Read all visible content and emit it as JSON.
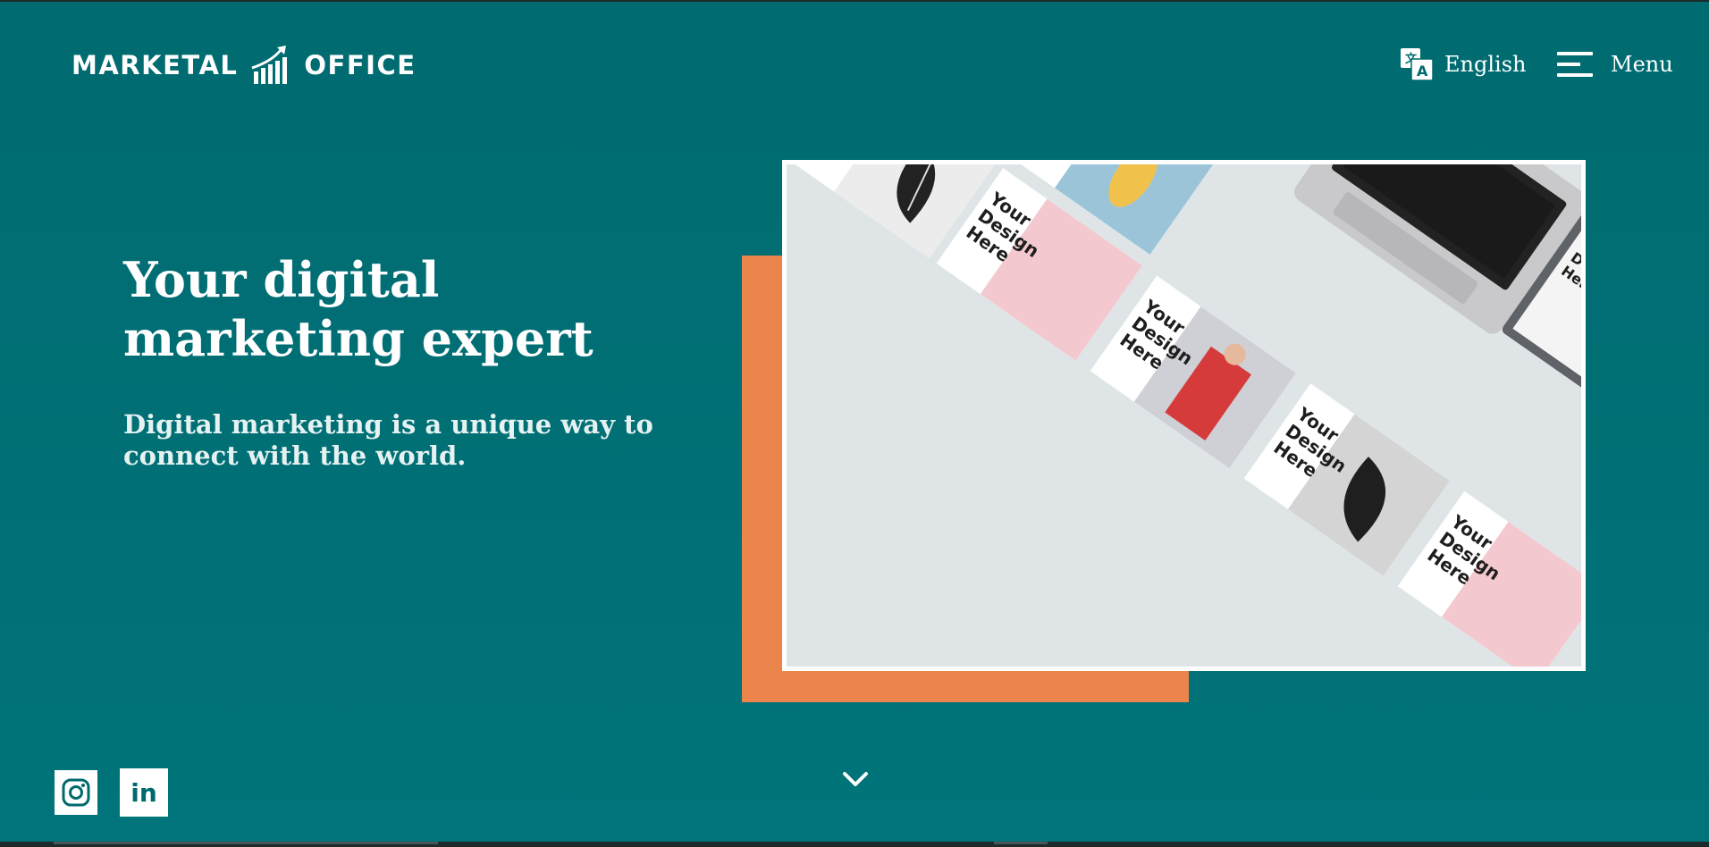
{
  "header": {
    "logo_left": "MARKETAL",
    "logo_right": "OFFICE",
    "language_label": "English",
    "menu_label": "Menu"
  },
  "hero": {
    "title_line1": "Your digital",
    "title_line2": "marketing expert",
    "subtitle_line1": "Digital marketing is a unique way to",
    "subtitle_line2": "connect with the world.",
    "mockup_text": [
      "Your",
      "Design",
      "Here"
    ]
  },
  "social": {
    "instagram_icon": "instagram-icon",
    "linkedin_label": "in"
  },
  "icons": {
    "logo_mark": "rising-chart-arrow-icon",
    "language": "translate-icon",
    "menu": "hamburger-icon",
    "scroll": "chevron-down-icon"
  },
  "colors": {
    "background": "#006b70",
    "accent": "#ec854c",
    "text": "#ffffff"
  }
}
